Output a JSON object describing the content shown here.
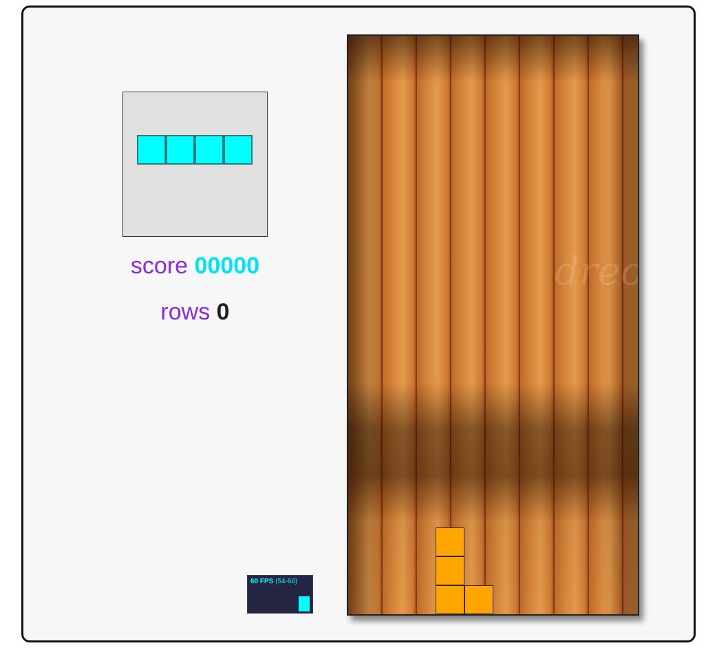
{
  "next_piece": {
    "shape": "I",
    "color": "#00ffff",
    "cells": [
      0,
      1,
      2,
      3
    ]
  },
  "score": {
    "label": "score",
    "value": "00000",
    "value_color": "#00e5ee"
  },
  "rows": {
    "label": "rows",
    "value": "0",
    "value_color": "#222222"
  },
  "fps_meter": {
    "fps": "60 FPS",
    "range": "(54-60)",
    "level": 0.65
  },
  "board": {
    "columns": 10,
    "rows": 20,
    "locked_color": "#ffa500",
    "locked_cells": [
      {
        "col": 3,
        "row": 17
      },
      {
        "col": 3,
        "row": 18
      },
      {
        "col": 3,
        "row": 19
      },
      {
        "col": 4,
        "row": 19
      }
    ]
  }
}
